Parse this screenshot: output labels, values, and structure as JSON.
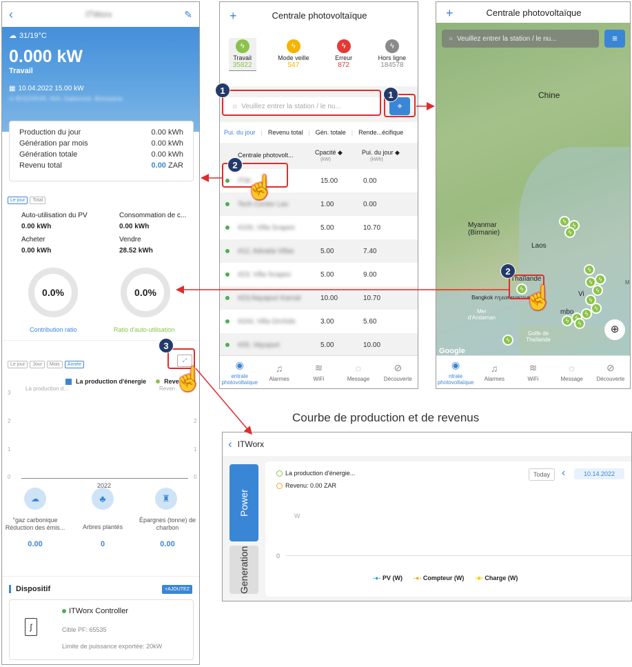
{
  "left": {
    "weather": "31/19°C",
    "power": "0.000 kW",
    "status": "Travail",
    "date_cap": "10.04.2022   15.00 kW",
    "card": [
      {
        "label": "Production du jour",
        "value": "0.00 kWh"
      },
      {
        "label": "Génération par mois",
        "value": "0.00 kWh"
      },
      {
        "label": "Génération totale",
        "value": "0.00 kWh"
      },
      {
        "label": "Revenu total",
        "value": "0.00",
        "unit": "ZAR"
      }
    ],
    "period_tabs": [
      "Le jour",
      "Total"
    ],
    "stats": [
      {
        "label": "Auto-utilisation du PV",
        "value": "0.00 kWh"
      },
      {
        "label": "Consommation de c...",
        "value": "0.00 kWh"
      },
      {
        "label": "Acheter",
        "value": "0.00 kWh"
      },
      {
        "label": "Vendre",
        "value": "28.52 kWh"
      }
    ],
    "ring1": {
      "pct": "0.0%",
      "label": "Contribution ratio"
    },
    "ring2": {
      "pct": "0.0%",
      "label": "Ratio d'auto-utilisation"
    },
    "chart_tabs": [
      "Le jour",
      "Jour",
      "Mois",
      "Année"
    ],
    "legend1": "La production d'énergie",
    "legend2": "Reve",
    "sublegend": "La production d...",
    "sublegend2": "Reven",
    "axis": [
      "3",
      "2",
      "1",
      "0"
    ],
    "year": "2022",
    "env": [
      {
        "label": "°gaz carbonique Réduction des émis...",
        "value": "0.00"
      },
      {
        "label": "Arbres plantés",
        "value": "0"
      },
      {
        "label": "Épargnes (tonne) de charbon",
        "value": "0.00"
      }
    ],
    "device_title": "Dispositif",
    "add_btn": "+AJOUTEZ",
    "device_name": "ITWorx Controller",
    "device_pf": "Cible PF: 65535",
    "device_limit": "Limite de puissance exportée: 20kW"
  },
  "mid": {
    "title": "Centrale photovoltaïque",
    "status": [
      {
        "label": "Travail",
        "count": "35822",
        "color": "#8bc34a"
      },
      {
        "label": "Mode veille",
        "count": "547",
        "color": "#f5b400"
      },
      {
        "label": "Erreur",
        "count": "872",
        "color": "#e53935"
      },
      {
        "label": "Hors ligne",
        "count": "184578",
        "color": "#8a8a8a"
      }
    ],
    "search_placeholder": "Veuillez entrer la station / le nu...",
    "sort_tabs": [
      "Pui. du jour",
      "Revenu total",
      "Gén. totale",
      "Rende...écifique"
    ],
    "col1": "Centrale photovolt...",
    "col2": "Cpacité ◆",
    "col2u": "(kW)",
    "col3": "Pui. du jour ◆",
    "col3u": "(kWh)",
    "rows": [
      {
        "name": "ITW...",
        "cap": "15.00",
        "day": "0.00"
      },
      {
        "name": "Tech Center Lao",
        "cap": "1.00",
        "day": "0.00"
      },
      {
        "name": "#100, Villa Scapes",
        "cap": "5.00",
        "day": "10.70"
      },
      {
        "name": "#12, Advaita Villas",
        "cap": "5.00",
        "day": "7.40"
      },
      {
        "name": "#23, Villa Scapes",
        "cap": "5.00",
        "day": "9.00"
      },
      {
        "name": "#23,Nayapuri Karnal",
        "cap": "10.00",
        "day": "10.70"
      },
      {
        "name": "#244, Villa Orchids",
        "cap": "3.00",
        "day": "5.60"
      },
      {
        "name": "#26, Vayupuri",
        "cap": "5.00",
        "day": "10.00"
      }
    ],
    "tabs": [
      "entrale photovoltaïque",
      "Alarmes",
      "WiFi",
      "Message",
      "Découverte"
    ]
  },
  "right": {
    "title": "Centrale photovoltaïque",
    "search_placeholder": "Veuillez entrer la station / le nu...",
    "labels": {
      "china": "Chine",
      "myanmar": "Myanmar (Birmanie)",
      "laos": "Laos",
      "thai": "Thaïlande",
      "bangkok": "Bangkok กรุงเทพมหานคร",
      "andaman": "Mer d'Andaman",
      "golfe": "Golfe de Thaïlande",
      "google": "Google",
      "vi": "Vi",
      "mbo": "mbo",
      "m": "M"
    },
    "tabs": [
      "ntrale photovoltaïque",
      "Alarmes",
      "WiFi",
      "Message",
      "Découverte"
    ]
  },
  "caption": "Courbe de production et de revenus",
  "bottom": {
    "back_title": "ITWorx",
    "power_tab": "Power",
    "gen_tab": "Generation",
    "legend1": "La production d'énergie...",
    "legend2": "Revenu:  0.00 ZAR",
    "today": "Today",
    "date": "10.14.2022",
    "unit": "W",
    "zero": "0",
    "series": [
      "PV (W)",
      "Compteur (W)",
      "Charge (W)"
    ]
  },
  "markers": [
    "1",
    "1",
    "2",
    "2",
    "3"
  ],
  "colors": {
    "accent": "#3a86d6",
    "red": "#e02b2b",
    "marker": "#233a6b",
    "green": "#4caf50"
  }
}
